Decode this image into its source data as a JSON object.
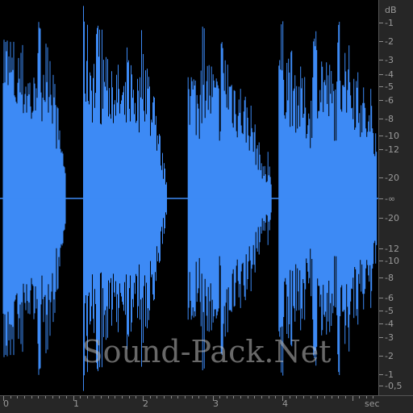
{
  "colors": {
    "waveform": "#3d8af5",
    "background": "#000000",
    "axis_bg": "#262626",
    "axis_text": "#9a9a9a"
  },
  "db_axis": {
    "unit": "dB",
    "labels": [
      "-1",
      "-2",
      "-3",
      "-4",
      "-5",
      "-6",
      "-8",
      "-10",
      "-12",
      "-20",
      "-∞",
      "-20",
      "-12",
      "-10",
      "-8",
      "-6",
      "-5",
      "-4",
      "-3",
      "-2",
      "-1",
      "-0,5"
    ]
  },
  "time_axis": {
    "labels": [
      "0",
      "1",
      "2",
      "3",
      "4"
    ],
    "unit": "sec"
  },
  "watermark": "Sound-Pack.Net",
  "waveform": {
    "clusters": [
      {
        "start": 0.0,
        "end": 0.9,
        "decay": 0.7
      },
      {
        "start": 1.15,
        "end": 2.35,
        "decay": 0.9
      },
      {
        "start": 2.65,
        "end": 3.85,
        "decay": 0.85
      },
      {
        "start": 3.95,
        "end": 5.35,
        "decay": 0.4
      }
    ]
  }
}
